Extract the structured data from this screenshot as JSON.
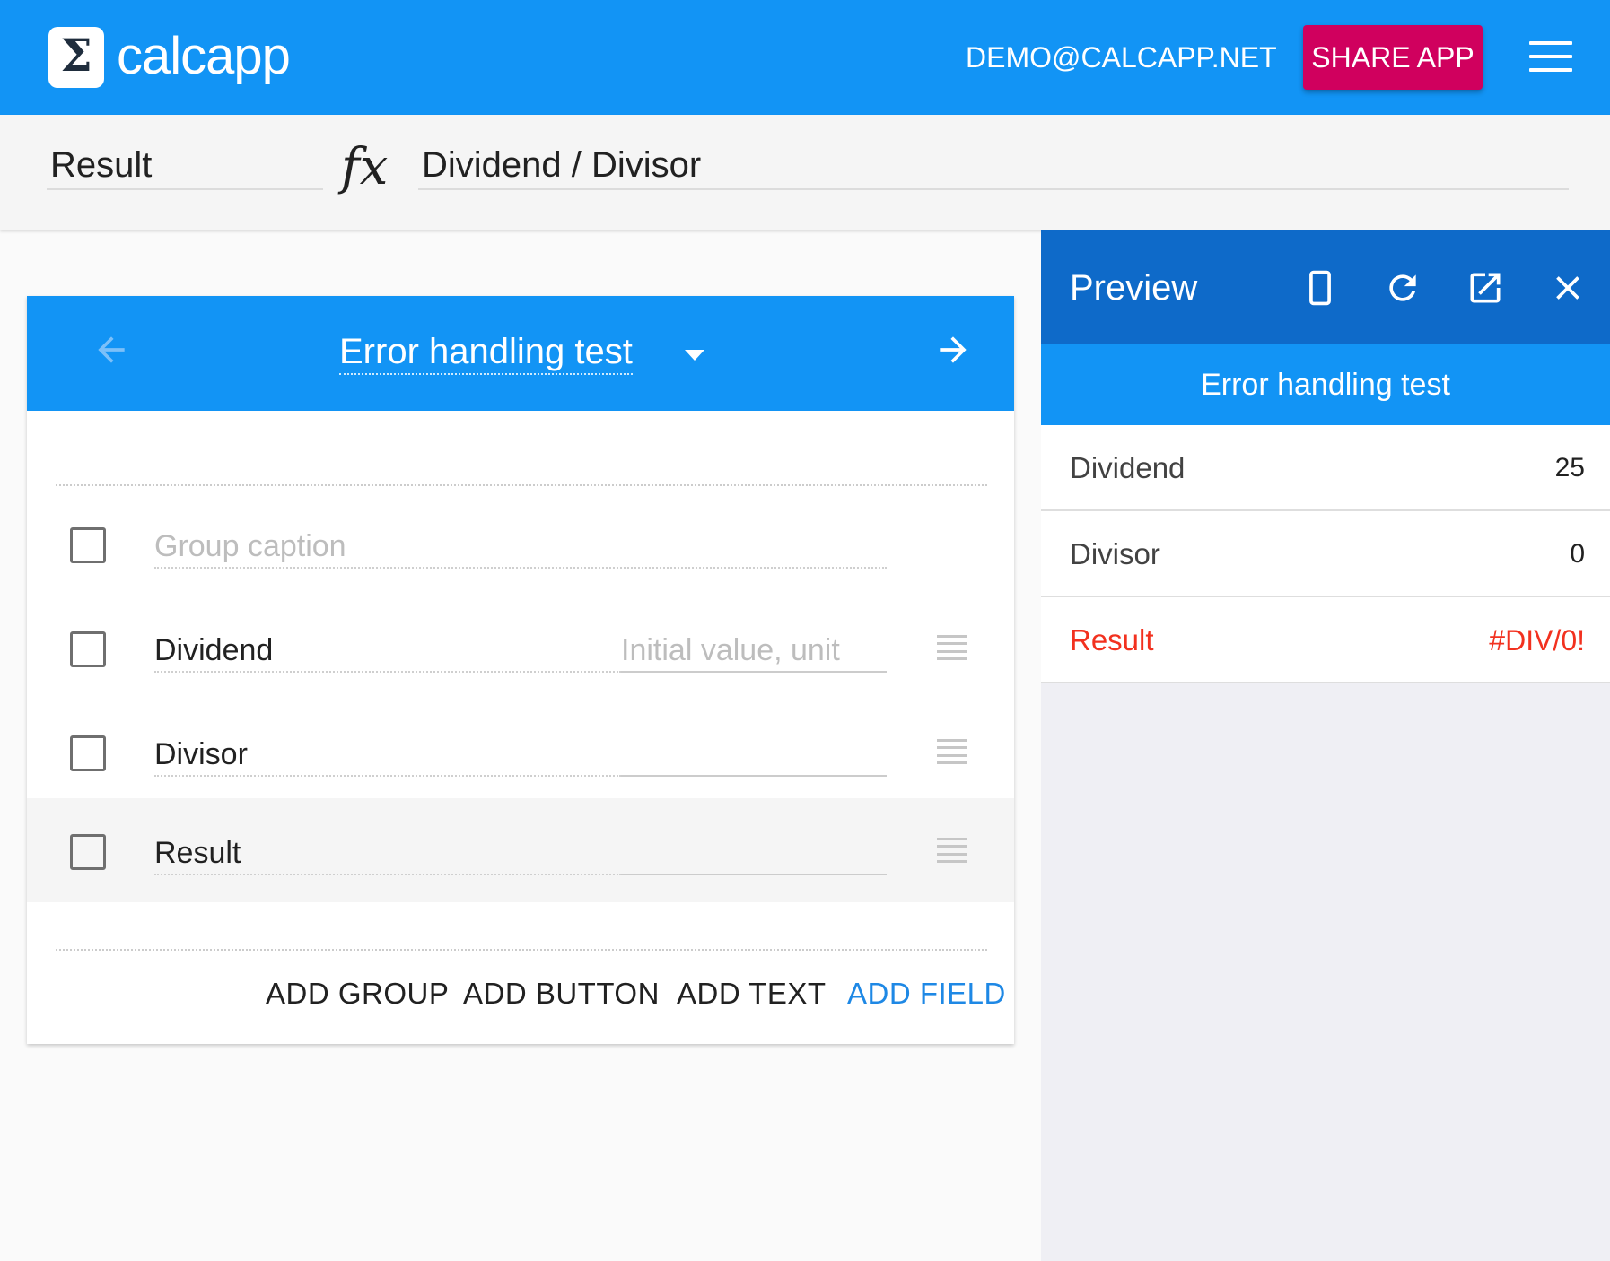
{
  "app": {
    "logo_symbol": "Σ",
    "logo_text": "calcapp",
    "user_email": "DEMO@CALCAPP.NET",
    "share_label": "SHARE APP"
  },
  "formula_bar": {
    "name": "Result",
    "fx_symbol": "fx",
    "formula": "Dividend / Divisor"
  },
  "editor": {
    "screen_title": "Error handling test",
    "group_caption_placeholder": "Group caption",
    "value_placeholder": "Initial value, unit",
    "fields": [
      {
        "name": "Dividend",
        "value": ""
      },
      {
        "name": "Divisor",
        "value": ""
      },
      {
        "name": "Result",
        "value": ""
      }
    ],
    "actions": {
      "add_group": "ADD GROUP",
      "add_button": "ADD BUTTON",
      "add_text": "ADD TEXT",
      "add_field": "ADD FIELD"
    }
  },
  "preview": {
    "title": "Preview",
    "app_title": "Error handling test",
    "rows": [
      {
        "label": "Dividend",
        "value": "25"
      },
      {
        "label": "Divisor",
        "value": "0"
      },
      {
        "label": "Result",
        "value": "#DIV/0!"
      }
    ]
  },
  "colors": {
    "primary": "#1294f5",
    "primary_dark": "#0e6ac9",
    "accent": "#d0005e",
    "error": "#f2311f",
    "link": "#1e88e5"
  }
}
